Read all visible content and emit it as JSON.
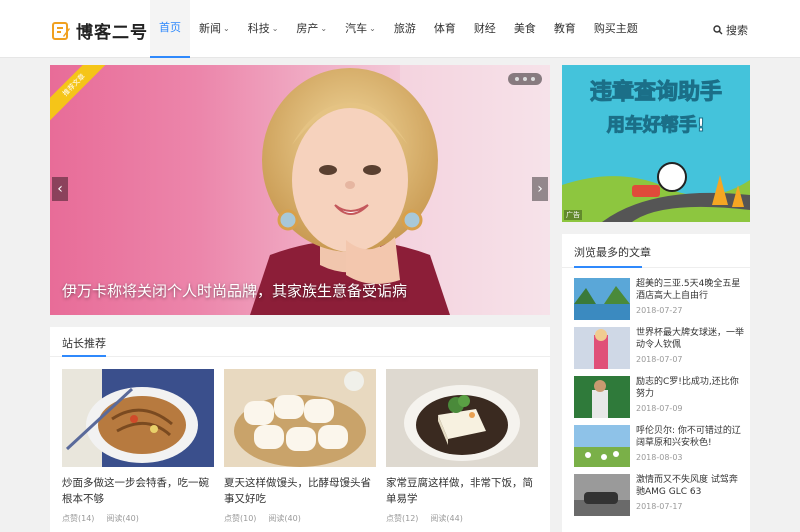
{
  "brand": {
    "name": "博客二号"
  },
  "nav": [
    {
      "label": "首页",
      "active": true,
      "dropdown": false
    },
    {
      "label": "新闻",
      "dropdown": true
    },
    {
      "label": "科技",
      "dropdown": true
    },
    {
      "label": "房产",
      "dropdown": true
    },
    {
      "label": "汽车",
      "dropdown": true
    },
    {
      "label": "旅游",
      "dropdown": false
    },
    {
      "label": "体育",
      "dropdown": false
    },
    {
      "label": "财经",
      "dropdown": false
    },
    {
      "label": "美食",
      "dropdown": false
    },
    {
      "label": "教育",
      "dropdown": false
    },
    {
      "label": "购买主题",
      "dropdown": false
    }
  ],
  "search": {
    "label": "搜索",
    "icon": "search-icon"
  },
  "slider": {
    "ribbon": "推荐文章",
    "caption": "伊万卡称将关闭个人时尚品牌，其家族生意备受诟病",
    "prev_icon": "chevron-left-icon",
    "next_icon": "chevron-right-icon"
  },
  "recommend": {
    "title": "站长推荐",
    "items": [
      {
        "title": "炒面多做这一步会特香，吃一碗根本不够",
        "likes": "点赞(14)",
        "reads": "阅读(40)"
      },
      {
        "title": "夏天这样做馒头，比酵母馒头省事又好吃",
        "likes": "点赞(10)",
        "reads": "阅读(40)"
      },
      {
        "title": "家常豆腐这样做，非常下饭，简单易学",
        "likes": "点赞(12)",
        "reads": "阅读(44)"
      }
    ]
  },
  "ad": {
    "headline1": "违章查询助手",
    "headline2": "用车好帮手!",
    "label": "广告"
  },
  "popular": {
    "title": "浏览最多的文章",
    "items": [
      {
        "title": "超美的三亚.5天4晚全五星酒店高大上自由行",
        "date": "2018-07-27"
      },
      {
        "title": "世界杯最大牌女球迷，一举动令人钦佩",
        "date": "2018-07-07"
      },
      {
        "title": "励志的C罗!比成功,还比你努力",
        "date": "2018-07-09"
      },
      {
        "title": "呼伦贝尔: 你不可错过的辽阔草原和兴安秋色!",
        "date": "2018-08-03"
      },
      {
        "title": "激情而又不失风度 试驾奔驰AMG GLC 63",
        "date": "2018-07-17"
      }
    ]
  },
  "colors": {
    "accent": "#2f89fc",
    "ribbon": "#f5c518"
  }
}
